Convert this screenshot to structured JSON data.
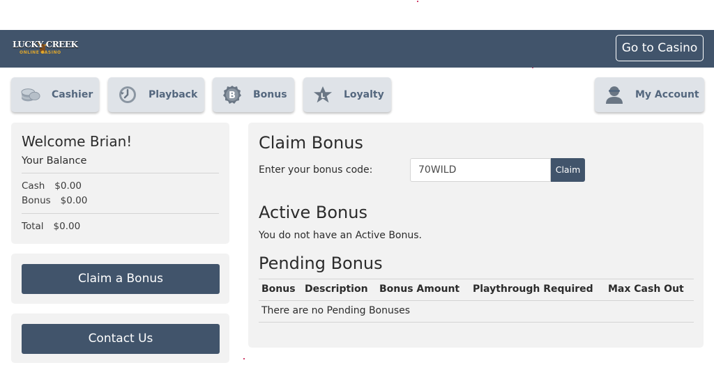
{
  "header": {
    "logo": {
      "top": "LUCKY CREEK",
      "bottom": "ONLINE CASINO"
    },
    "go_casino_label": "Go to Casino"
  },
  "nav": {
    "cashier": {
      "label": "Cashier",
      "icon": "chips-icon"
    },
    "playback": {
      "label": "Playback",
      "icon": "playback-icon"
    },
    "bonus": {
      "label": "Bonus",
      "icon": "bonus-coin-icon"
    },
    "loyalty": {
      "label": "Loyalty",
      "icon": "loyalty-star-icon"
    },
    "account": {
      "label": "My Account",
      "icon": "user-icon"
    }
  },
  "balance": {
    "welcome": "Welcome Brian!",
    "title": "Your Balance",
    "cash_label": "Cash",
    "cash_value": "$0.00",
    "bonus_label": "Bonus",
    "bonus_value": "$0.00",
    "total_label": "Total",
    "total_value": "$0.00"
  },
  "actions": {
    "claim_bonus": "Claim a Bonus",
    "contact_us": "Contact Us"
  },
  "claim": {
    "title": "Claim Bonus",
    "code_label": "Enter your bonus code:",
    "code_value": "70WILD",
    "claim_label": "Claim"
  },
  "active": {
    "title": "Active Bonus",
    "message": "You do not have an Active Bonus."
  },
  "pending": {
    "title": "Pending Bonus",
    "columns": [
      "Bonus",
      "Description",
      "Bonus Amount",
      "Playthrough Required",
      "Max Cash Out"
    ],
    "empty_message": "There are no Pending Bonuses"
  },
  "colors": {
    "header": "#41546b",
    "button": "#41546b",
    "panel": "#f2f2f2",
    "nav_button": "#dfe3e8",
    "nav_text": "#54677e"
  }
}
